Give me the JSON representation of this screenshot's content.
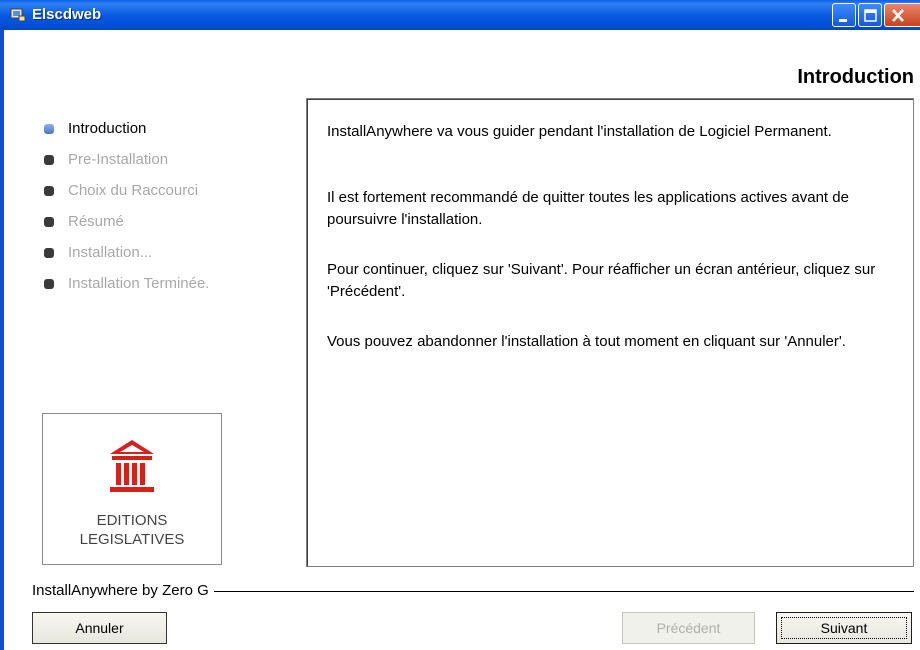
{
  "window": {
    "title": "Elscdweb"
  },
  "header": {
    "title": "Introduction"
  },
  "steps": [
    {
      "label": "Introduction",
      "active": true
    },
    {
      "label": "Pre-Installation",
      "active": false
    },
    {
      "label": "Choix du Raccourci",
      "active": false
    },
    {
      "label": "Résumé",
      "active": false
    },
    {
      "label": "Installation...",
      "active": false
    },
    {
      "label": "Installation Terminée.",
      "active": false
    }
  ],
  "logo": {
    "line1": "EDITIONS",
    "line2": "LEGISLATIVES",
    "color": "#d6201c"
  },
  "content": {
    "p1": "InstallAnywhere va vous guider pendant l'installation de Logiciel Permanent.",
    "p2": "Il est fortement recommandé de quitter toutes les applications actives avant de poursuivre l'installation.",
    "p3": "Pour continuer, cliquez sur 'Suivant'. Pour réafficher un écran antérieur, cliquez sur 'Précédent'.",
    "p4": "Vous pouvez abandonner l'installation à tout moment en cliquant sur 'Annuler'."
  },
  "footer": {
    "vendor": "InstallAnywhere by Zero G",
    "cancel_label": "Annuler",
    "prev_label": "Précédent",
    "next_label": "Suivant"
  },
  "titlebar_buttons": [
    "minimize-icon",
    "maximize-icon",
    "close-icon"
  ]
}
